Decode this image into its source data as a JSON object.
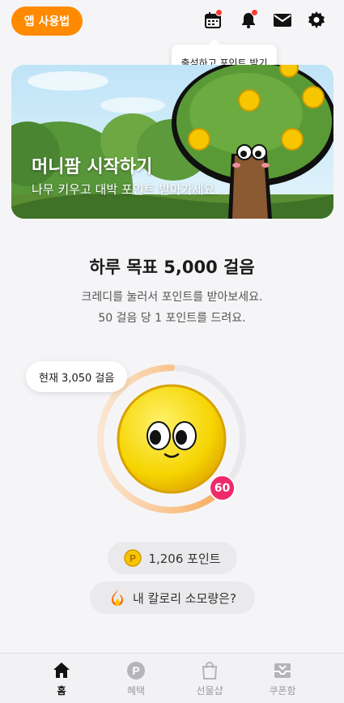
{
  "header": {
    "app_usage_label": "앱 사용법",
    "icons": [
      "calendar-icon",
      "bell-icon",
      "mail-icon",
      "gear-icon"
    ]
  },
  "tooltip": {
    "text": "출석하고 포인트 받기"
  },
  "banner": {
    "title": "머니팜 시작하기",
    "subtitle": "나무 키우고 대박 포인트 받아가세요."
  },
  "goal": {
    "title": "하루 목표 5,000 걸음",
    "desc_line1": "크레디를 눌러서 포인트를 받아보세요.",
    "desc_line2": "50 걸음 당 1 포인트를 드려요."
  },
  "steps": {
    "current_label": "현재 3,050 걸음",
    "progress_fraction": 0.61,
    "credit_count": "60"
  },
  "points": {
    "label": "1,206 포인트"
  },
  "calories": {
    "label": "내 칼로리 소모량은?"
  },
  "nav": {
    "items": [
      {
        "label": "홈",
        "icon": "home-icon",
        "active": true
      },
      {
        "label": "혜택",
        "icon": "point-icon",
        "active": false
      },
      {
        "label": "선물샵",
        "icon": "shopping-bag-icon",
        "active": false
      },
      {
        "label": "쿠폰함",
        "icon": "coupon-box-icon",
        "active": false
      }
    ]
  },
  "colors": {
    "accent": "#ff8a00",
    "badge": "#ee2a6b",
    "coin": "#f7c600"
  }
}
